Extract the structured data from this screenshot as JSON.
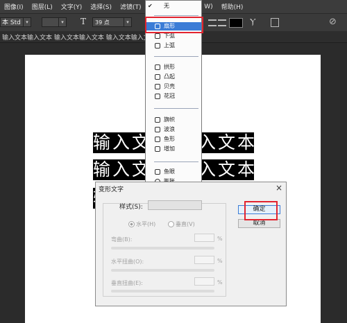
{
  "menubar": {
    "items": [
      "图像(I)",
      "图层(L)",
      "文字(Y)",
      "选择(S)",
      "滤镜(T)",
      "3D",
      "W)",
      "帮助(H)"
    ]
  },
  "options_bar": {
    "font_family": "本 Std",
    "font_size": "39 点",
    "color_swatch": "#000000"
  },
  "document_tab": {
    "title": "输入文本输入文本 输入文本输入文本 输入文本输入文本 输入文..."
  },
  "canvas": {
    "lines": [
      "输入文",
      "输入文本",
      "输入文本"
    ],
    "right_lines": [
      "入文本",
      "入文本"
    ],
    "third_line_fragment": "输"
  },
  "warp_menu": {
    "none_label": "无",
    "groups": [
      [
        {
          "label": "扇形",
          "icon": "arc-icon",
          "selected": true
        },
        {
          "label": "下弧",
          "icon": "arc-lower-icon"
        },
        {
          "label": "上弧",
          "icon": "arc-upper-icon"
        }
      ],
      [
        {
          "label": "拱形",
          "icon": "arch-icon"
        },
        {
          "label": "凸起",
          "icon": "bulge-icon"
        },
        {
          "label": "贝壳",
          "icon": "shell-icon"
        },
        {
          "label": "花冠",
          "icon": "flag-crown-icon"
        }
      ],
      [
        {
          "label": "旗帜",
          "icon": "flag-icon"
        },
        {
          "label": "波浪",
          "icon": "wave-icon"
        },
        {
          "label": "鱼形",
          "icon": "fish-icon"
        },
        {
          "label": "增加",
          "icon": "rise-icon"
        }
      ],
      [
        {
          "label": "鱼眼",
          "icon": "fisheye-icon"
        },
        {
          "label": "膨胀",
          "icon": "inflate-icon"
        },
        {
          "label": "挤压",
          "icon": "squeeze-icon"
        },
        {
          "label": "扭转",
          "icon": "twist-icon"
        }
      ]
    ]
  },
  "warp_dialog": {
    "title": "变形文字",
    "close": "×",
    "style_label": "样式(S):",
    "horizontal_label": "水平(H)",
    "vertical_label": "垂直(V)",
    "bend_label": "弯曲(B):",
    "hdistort_label": "水平扭曲(O):",
    "vdistort_label": "垂直扭曲(E):",
    "percent": "%",
    "ok_label": "确定",
    "cancel_label": "取消",
    "orientation": "horizontal"
  },
  "colors": {
    "highlight": "#3b7cd6",
    "annotation_red": "#e2232f"
  }
}
